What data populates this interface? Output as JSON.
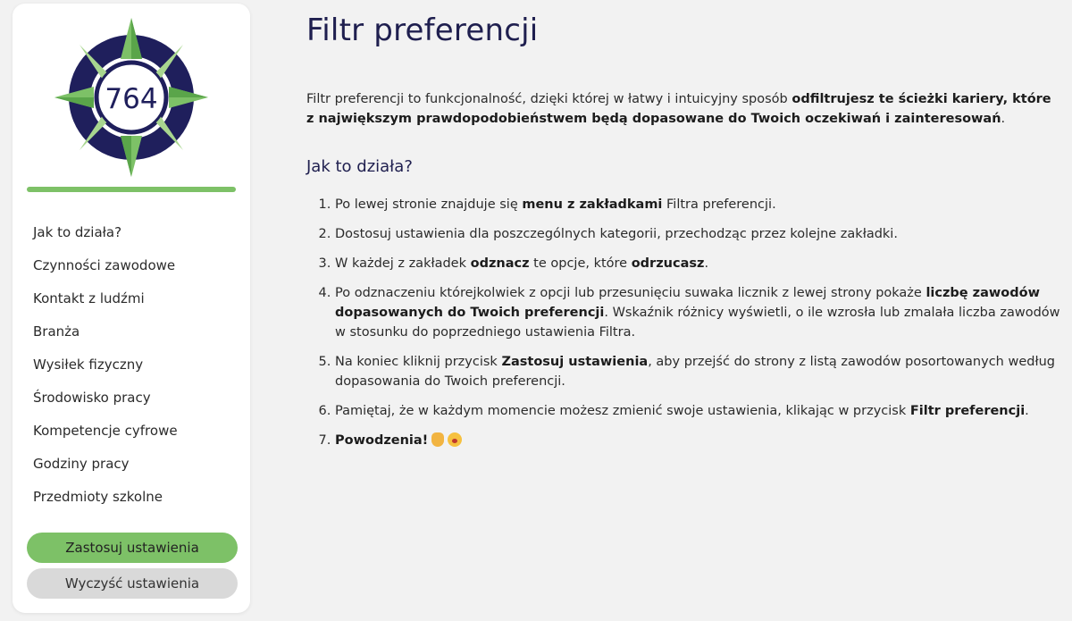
{
  "sidebar": {
    "logo_number": "764",
    "items": [
      {
        "label": "Jak to działa?"
      },
      {
        "label": "Czynności zawodowe"
      },
      {
        "label": "Kontakt z ludźmi"
      },
      {
        "label": "Branża"
      },
      {
        "label": "Wysiłek fizyczny"
      },
      {
        "label": "Środowisko pracy"
      },
      {
        "label": "Kompetencje cyfrowe"
      },
      {
        "label": "Godziny pracy"
      },
      {
        "label": "Przedmioty szkolne"
      }
    ],
    "apply_label": "Zastosuj ustawienia",
    "clear_label": "Wyczyść ustawienia"
  },
  "main": {
    "title": "Filtr preferencji",
    "intro": {
      "pre": "Filtr preferencji to funkcjonalność, dzięki której w łatwy i intuicyjny sposób ",
      "bold": "odfiltrujesz te ścieżki kariery, które z największym prawdopodobieństwem będą dopasowane do Twoich oczekiwań i zainteresowań",
      "post": "."
    },
    "howto_heading": "Jak to działa?",
    "steps": [
      {
        "parts": [
          {
            "t": "Po lewej stronie znajduje się "
          },
          {
            "t": "menu z zakładkami",
            "b": true
          },
          {
            "t": " Filtra preferencji."
          }
        ]
      },
      {
        "parts": [
          {
            "t": "Dostosuj ustawienia dla poszczególnych kategorii, przechodząc przez kolejne zakładki."
          }
        ]
      },
      {
        "parts": [
          {
            "t": "W każdej z zakładek "
          },
          {
            "t": "odznacz",
            "b": true
          },
          {
            "t": " te opcje, które "
          },
          {
            "t": "odrzucasz",
            "b": true
          },
          {
            "t": "."
          }
        ]
      },
      {
        "parts": [
          {
            "t": "Po odznaczeniu którejkolwiek z opcji lub przesunięciu suwaka licznik z lewej strony pokaże "
          },
          {
            "t": "liczbę zawodów dopasowanych do Twoich preferencji",
            "b": true
          },
          {
            "t": ". Wskaźnik różnicy wyświetli, o ile wzrosła lub zmalała liczba zawodów w stosunku do poprzedniego ustawienia Filtra."
          }
        ]
      },
      {
        "parts": [
          {
            "t": "Na koniec kliknij przycisk "
          },
          {
            "t": "Zastosuj ustawienia",
            "b": true
          },
          {
            "t": ", aby przejść do strony z listą zawodów posortowanych według dopasowania do Twoich preferencji."
          }
        ]
      },
      {
        "parts": [
          {
            "t": "Pamiętaj, że w każdym momencie możesz zmienić swoje ustawienia, klikając w przycisk "
          },
          {
            "t": "Filtr preferencji",
            "b": true
          },
          {
            "t": "."
          }
        ]
      },
      {
        "parts": [
          {
            "t": "Powodzenia!",
            "b": true
          }
        ],
        "emoji": [
          "waving-hand-emoji",
          "smiling-face-emoji"
        ]
      }
    ]
  },
  "colors": {
    "accent_green": "#7dc167",
    "navy": "#1f1f4f",
    "button_gray": "#d9d9d9"
  }
}
